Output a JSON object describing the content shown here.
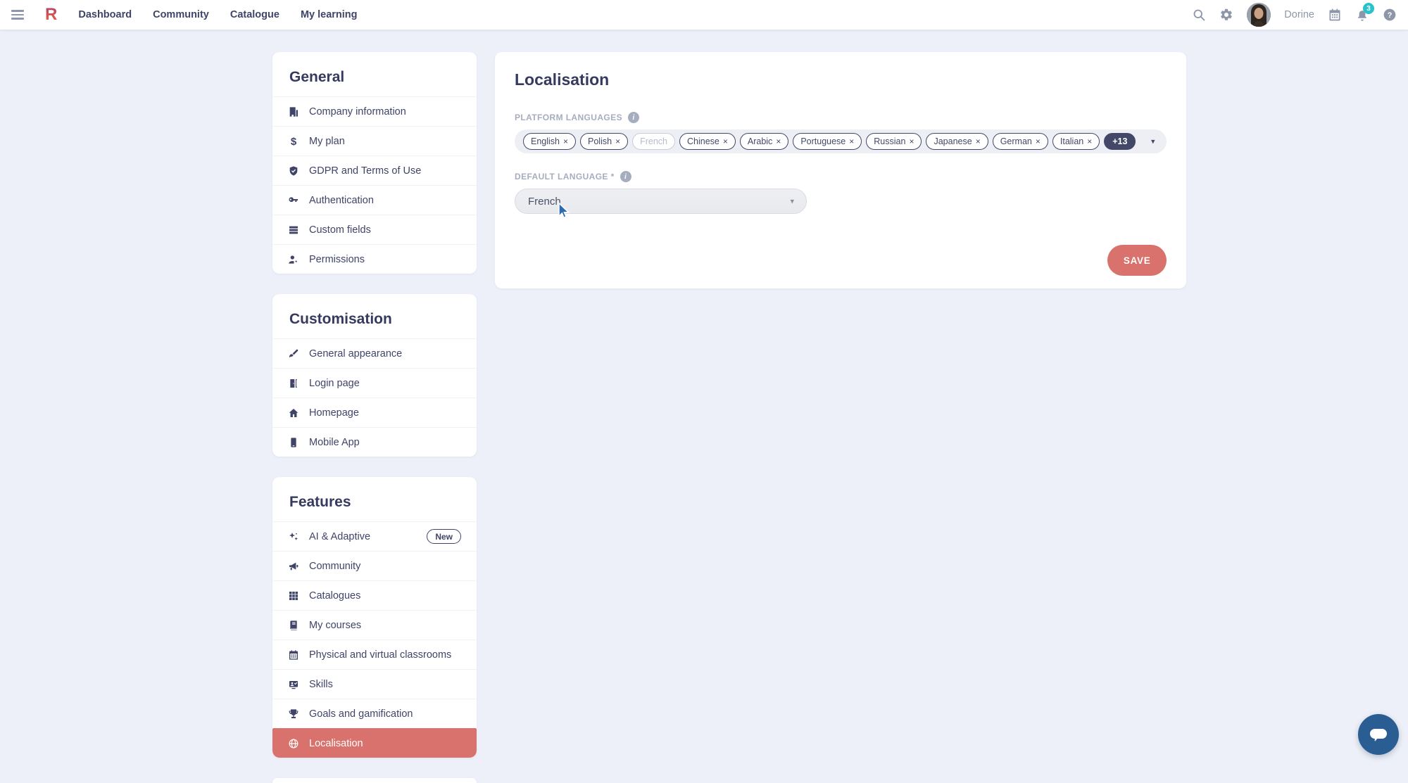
{
  "topbar": {
    "logo_text": "R",
    "nav": [
      {
        "label": "Dashboard"
      },
      {
        "label": "Community"
      },
      {
        "label": "Catalogue"
      },
      {
        "label": "My learning"
      }
    ],
    "user_name": "Dorine",
    "notification_count": "3"
  },
  "sidebar": {
    "sections": [
      {
        "title": "General",
        "items": [
          {
            "label": "Company information"
          },
          {
            "label": "My plan"
          },
          {
            "label": "GDPR and Terms of Use"
          },
          {
            "label": "Authentication"
          },
          {
            "label": "Custom fields"
          },
          {
            "label": "Permissions"
          }
        ]
      },
      {
        "title": "Customisation",
        "items": [
          {
            "label": "General appearance"
          },
          {
            "label": "Login page"
          },
          {
            "label": "Homepage"
          },
          {
            "label": "Mobile App"
          }
        ]
      },
      {
        "title": "Features",
        "items": [
          {
            "label": "AI & Adaptive",
            "badge": "New"
          },
          {
            "label": "Community"
          },
          {
            "label": "Catalogues"
          },
          {
            "label": "My courses"
          },
          {
            "label": "Physical and virtual classrooms"
          },
          {
            "label": "Skills"
          },
          {
            "label": "Goals and gamification"
          },
          {
            "label": "Localisation",
            "active": true
          }
        ]
      }
    ]
  },
  "main": {
    "title": "Localisation",
    "platform_languages": {
      "label": "PLATFORM LANGUAGES",
      "tags": [
        {
          "label": "English",
          "removable": true
        },
        {
          "label": "Polish",
          "removable": true
        },
        {
          "label": "French",
          "removable": false
        },
        {
          "label": "Chinese",
          "removable": true
        },
        {
          "label": "Arabic",
          "removable": true
        },
        {
          "label": "Portuguese",
          "removable": true
        },
        {
          "label": "Russian",
          "removable": true
        },
        {
          "label": "Japanese",
          "removable": true
        },
        {
          "label": "German",
          "removable": true
        },
        {
          "label": "Italian",
          "removable": true
        }
      ],
      "overflow_label": "+13"
    },
    "default_language": {
      "label": "DEFAULT LANGUAGE *",
      "value": "French"
    },
    "save_label": "SAVE"
  },
  "glyphs": {
    "remove": "×",
    "caret": "▾",
    "info": "i",
    "help": "?",
    "dollar": "$"
  },
  "colors": {
    "accent": "#d9716c",
    "navy": "#3f4468",
    "label_gray": "#a6adbf",
    "badge_teal": "#29c3c9",
    "chat_blue": "#2a5d92",
    "page_bg": "#edf0f8"
  }
}
